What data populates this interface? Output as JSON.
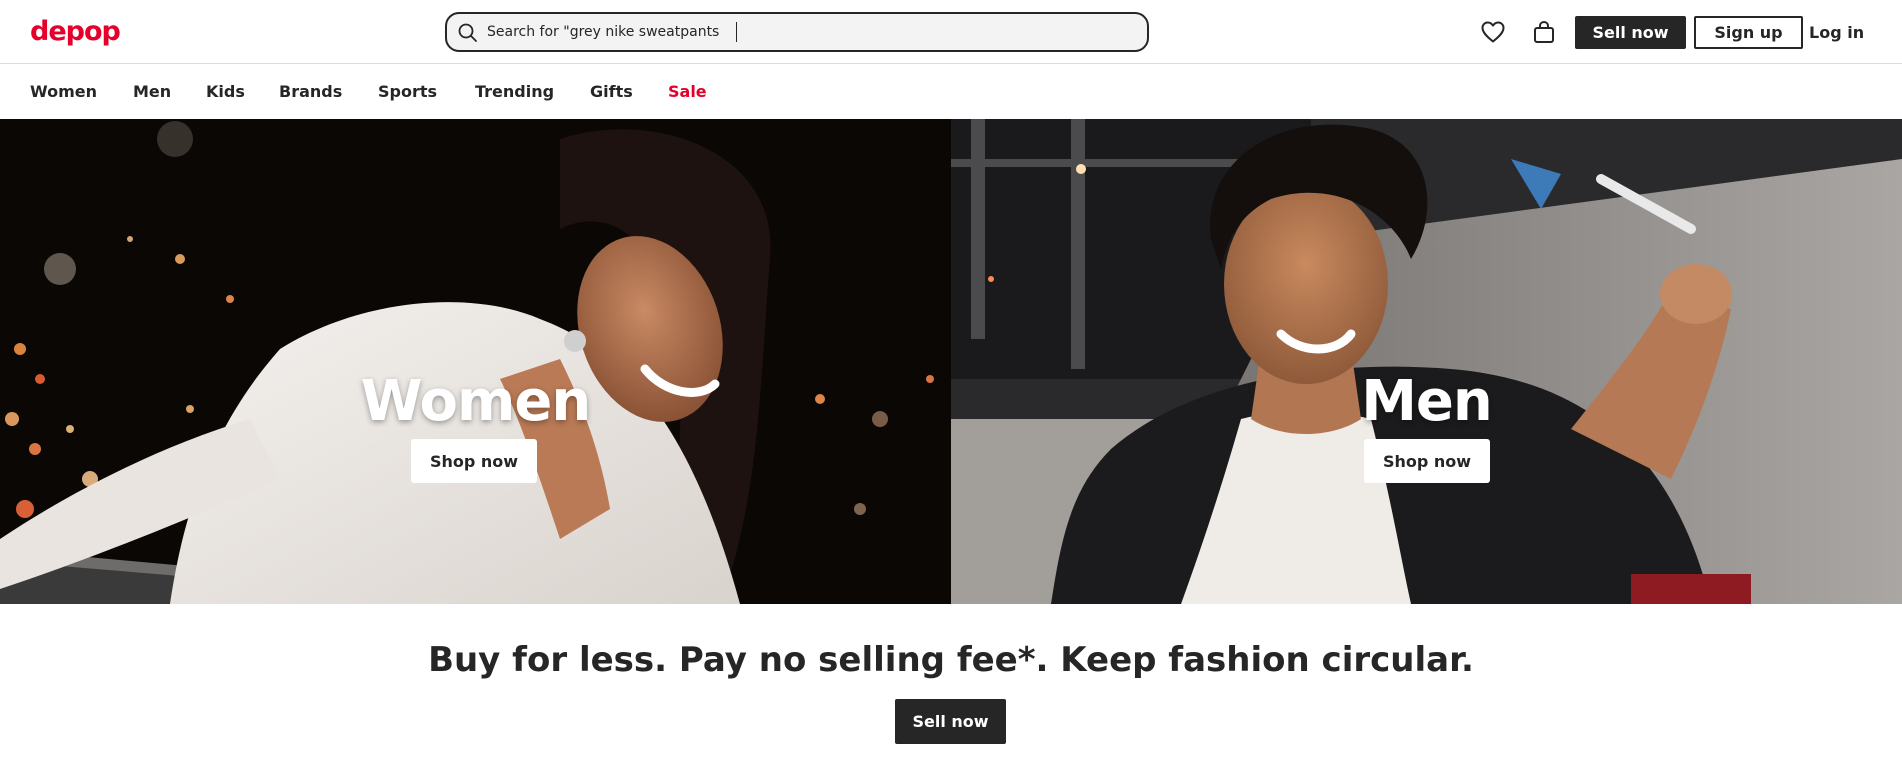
{
  "header": {
    "logo": "depop",
    "search": {
      "placeholder": "Search for \"grey nike sweatpants",
      "icon": "search-icon"
    },
    "icons": [
      "heart-icon",
      "shopping-bag-icon"
    ],
    "sell_label": "Sell now",
    "signup_label": "Sign up",
    "login_label": "Log in"
  },
  "nav": {
    "items": [
      {
        "label": "Women"
      },
      {
        "label": "Men"
      },
      {
        "label": "Kids"
      },
      {
        "label": "Brands"
      },
      {
        "label": "Sports"
      },
      {
        "label": "Trending"
      },
      {
        "label": "Gifts"
      },
      {
        "label": "Sale"
      }
    ]
  },
  "hero": {
    "left": {
      "title": "Women",
      "button": "Shop now"
    },
    "right": {
      "title": "Men",
      "button": "Shop now"
    }
  },
  "promo": {
    "tagline": "Buy for less. Pay no selling fee*. Keep fashion circular.",
    "button": "Sell now"
  },
  "colors": {
    "brand": "#e4002b",
    "dark": "#262626",
    "sale": "#e4002b"
  }
}
